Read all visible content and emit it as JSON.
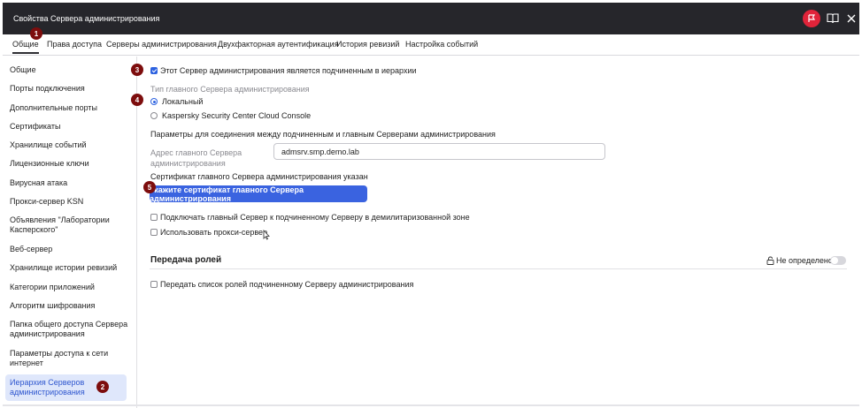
{
  "window": {
    "title": "Свойства Сервера администрирования"
  },
  "colors": {
    "titlebar_bg": "#26262b",
    "accent": "#3a63e0",
    "flag_button": "#e0243a",
    "badge": "#7d0d0d"
  },
  "tabs": [
    {
      "label": "Общие",
      "active": true
    },
    {
      "label": "Права доступа"
    },
    {
      "label": "Серверы администрирования"
    },
    {
      "label": "Двухфакторная аутентификация"
    },
    {
      "label": "История ревизий"
    },
    {
      "label": "Настройка событий"
    }
  ],
  "sidebar": {
    "items": [
      {
        "label": "Общие"
      },
      {
        "label": "Порты подключения"
      },
      {
        "label": "Дополнительные порты"
      },
      {
        "label": "Сертификаты"
      },
      {
        "label": "Хранилище событий"
      },
      {
        "label": "Лицензионные ключи"
      },
      {
        "label": "Вирусная атака"
      },
      {
        "label": "Прокси-сервер KSN"
      },
      {
        "label": "Объявления \"Лаборатории Касперского\""
      },
      {
        "label": "Веб-сервер"
      },
      {
        "label": "Хранилище истории ревизий"
      },
      {
        "label": "Категории приложений"
      },
      {
        "label": "Алгоритм шифрования"
      },
      {
        "label": "Папка общего доступа Сервера администрирования"
      },
      {
        "label": "Параметры доступа к сети интернет"
      },
      {
        "label": "Иерархия Серверов администрирования",
        "active": true
      }
    ]
  },
  "badges": [
    "1",
    "2",
    "3",
    "4",
    "5"
  ],
  "main": {
    "subordinate_checkbox": {
      "label": "Этот Сервер администрирования является подчиненным в иерархии",
      "checked": true
    },
    "master_type": {
      "label": "Тип главного Сервера администрирования",
      "options": [
        {
          "label": "Локальный",
          "selected": true
        },
        {
          "label": "Kaspersky Security Center Cloud Console",
          "selected": false
        }
      ]
    },
    "connection_params_label": "Параметры для соединения между подчиненным и главным Серверами администрирования",
    "master_address": {
      "label": "Адрес главного Сервера администрирования",
      "value": "admsrv.smp.demo.lab"
    },
    "cert_status": "Сертификат главного Сервера администрирования указан",
    "cert_button": "Укажите сертификат главного Сервера администрирования",
    "dmz_checkbox": {
      "label": "Подключать главный Сервер к подчиненному Серверу в демилитаризованной зоне",
      "checked": false
    },
    "proxy_checkbox": {
      "label": "Использовать прокси-сервер",
      "checked": false
    },
    "roles_section": {
      "title": "Передача ролей",
      "lock_status": "Не определено",
      "toggle_on": false,
      "checkbox": {
        "label": "Передать список ролей подчиненному Серверу администрирования",
        "checked": false
      }
    }
  },
  "icons": [
    "flag-icon",
    "book-icon",
    "close-icon",
    "lock-icon",
    "mouse-cursor-icon"
  ]
}
